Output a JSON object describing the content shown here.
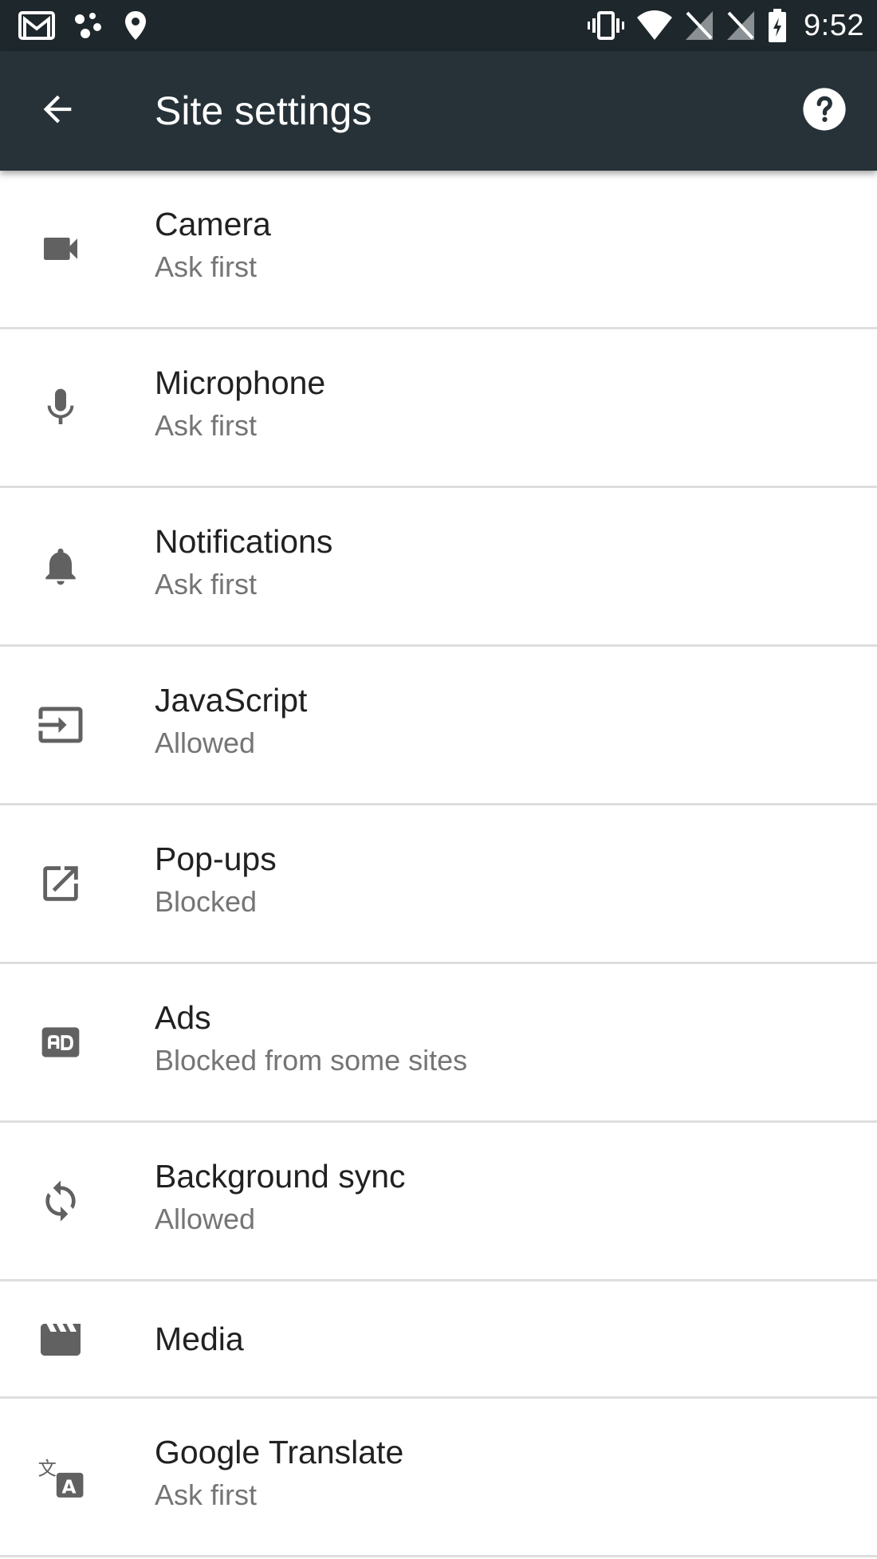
{
  "status_bar": {
    "time": "9:52",
    "icons": [
      "gmail-icon",
      "assistant-dots-icon",
      "location-pin-icon",
      "vibrate-icon",
      "wifi-icon",
      "no-signal-icon",
      "no-signal-icon",
      "battery-icon"
    ]
  },
  "app_bar": {
    "title": "Site settings",
    "back_icon": "arrow-back-icon",
    "help_icon": "help-icon",
    "background": "#263238"
  },
  "settings": [
    {
      "id": "camera",
      "icon": "videocam-icon",
      "title": "Camera",
      "summary": "Ask first"
    },
    {
      "id": "microphone",
      "icon": "mic-icon",
      "title": "Microphone",
      "summary": "Ask first"
    },
    {
      "id": "notifications",
      "icon": "bell-icon",
      "title": "Notifications",
      "summary": "Ask first"
    },
    {
      "id": "javascript",
      "icon": "input-icon",
      "title": "JavaScript",
      "summary": "Allowed"
    },
    {
      "id": "popups",
      "icon": "open-in-new-icon",
      "title": "Pop-ups",
      "summary": "Blocked"
    },
    {
      "id": "ads",
      "icon": "ad-units-icon",
      "title": "Ads",
      "summary": "Blocked from some sites"
    },
    {
      "id": "background-sync",
      "icon": "sync-icon",
      "title": "Background sync",
      "summary": "Allowed"
    },
    {
      "id": "media",
      "icon": "clapperboard-icon",
      "title": "Media",
      "summary": ""
    },
    {
      "id": "google-translate",
      "icon": "translate-icon",
      "title": "Google Translate",
      "summary": "Ask first"
    }
  ],
  "colors": {
    "status_bar": "#1e272c",
    "icon": "#616161",
    "title_text": "#212121",
    "summary_text": "#757575",
    "divider": "#dedede"
  }
}
